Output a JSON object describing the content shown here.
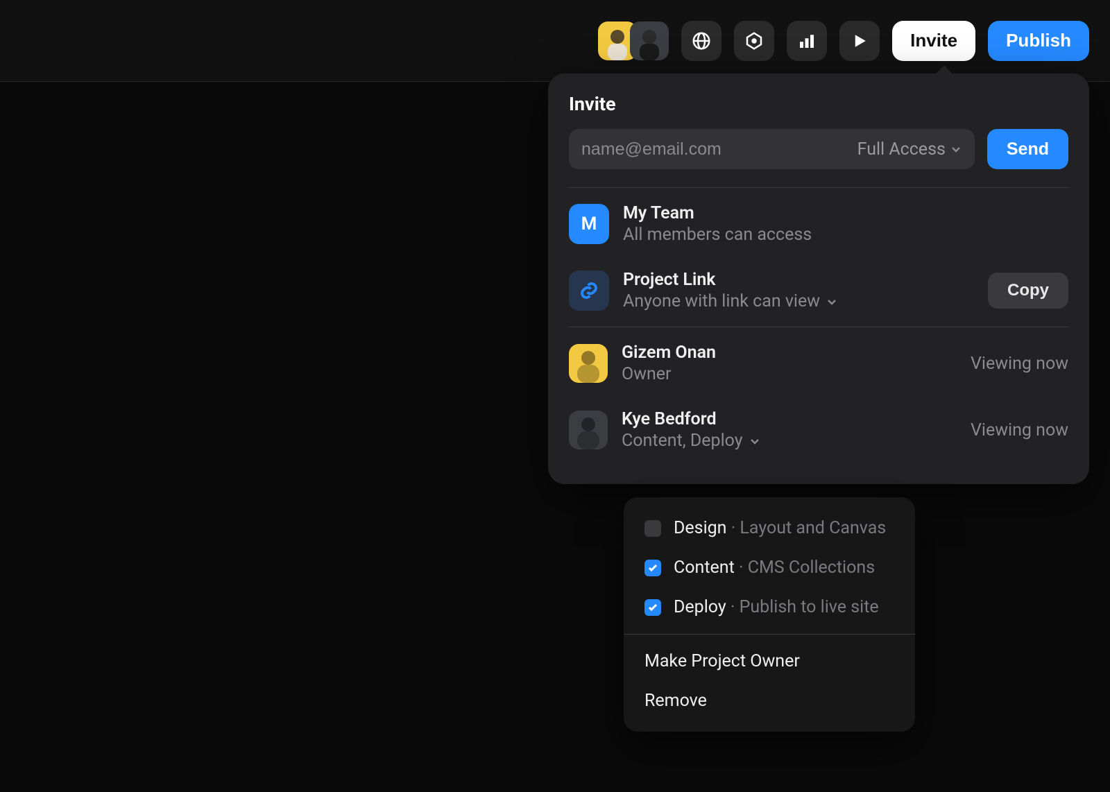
{
  "topbar": {
    "invite_label": "Invite",
    "publish_label": "Publish"
  },
  "popover": {
    "title": "Invite",
    "email_placeholder": "name@email.com",
    "access_label": "Full Access",
    "send_label": "Send",
    "team": {
      "initial": "M",
      "name": "My Team",
      "desc": "All members can access"
    },
    "project_link": {
      "name": "Project Link",
      "desc": "Anyone with link can view",
      "copy_label": "Copy"
    },
    "members": [
      {
        "name": "Gizem Onan",
        "role": "Owner",
        "status": "Viewing now",
        "avatar_bg": "#f3c941"
      },
      {
        "name": "Kye Bedford",
        "role": "Content, Deploy",
        "status": "Viewing now",
        "avatar_bg": "#3a3d42",
        "has_chevron": true
      }
    ]
  },
  "dropdown": {
    "permissions": [
      {
        "name": "Design",
        "desc": "Layout and Canvas",
        "checked": false
      },
      {
        "name": "Content",
        "desc": "CMS Collections",
        "checked": true
      },
      {
        "name": "Deploy",
        "desc": "Publish to live site",
        "checked": true
      }
    ],
    "actions": [
      "Make Project Owner",
      "Remove"
    ]
  }
}
